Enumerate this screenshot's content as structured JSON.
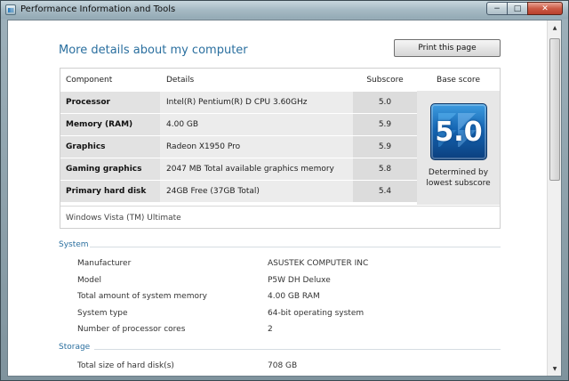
{
  "window": {
    "title": "Performance Information and Tools",
    "minimize": "−",
    "maximize": "□",
    "close": "✕"
  },
  "page": {
    "heading": "More details about my computer",
    "print_label": "Print this page"
  },
  "score_table": {
    "headers": {
      "component": "Component",
      "details": "Details",
      "subscore": "Subscore",
      "base_score": "Base score"
    },
    "rows": [
      {
        "component": "Processor",
        "details": "Intel(R) Pentium(R) D CPU 3.60GHz",
        "subscore": "5.0"
      },
      {
        "component": "Memory (RAM)",
        "details": "4.00 GB",
        "subscore": "5.9"
      },
      {
        "component": "Graphics",
        "details": "Radeon X1950 Pro",
        "subscore": "5.9"
      },
      {
        "component": "Gaming graphics",
        "details": "2047 MB Total available graphics memory",
        "subscore": "5.8"
      },
      {
        "component": "Primary hard disk",
        "details": "24GB Free (37GB Total)",
        "subscore": "5.4"
      }
    ],
    "base_score": "5.0",
    "base_caption": "Determined by lowest subscore",
    "os": "Windows Vista (TM) Ultimate"
  },
  "system": {
    "title": "System",
    "items": [
      {
        "label": "Manufacturer",
        "value": "ASUSTEK COMPUTER INC"
      },
      {
        "label": "Model",
        "value": "P5W DH Deluxe"
      },
      {
        "label": "Total amount of system memory",
        "value": "4.00 GB RAM"
      },
      {
        "label": "System type",
        "value": "64-bit operating system"
      },
      {
        "label": "Number of processor cores",
        "value": "2"
      }
    ]
  },
  "storage": {
    "title": "Storage",
    "items": [
      {
        "label": "Total size of hard disk(s)",
        "value": "708 GB"
      }
    ]
  },
  "colors": {
    "heading": "#2a6f9f",
    "badge": "#1566b3"
  }
}
